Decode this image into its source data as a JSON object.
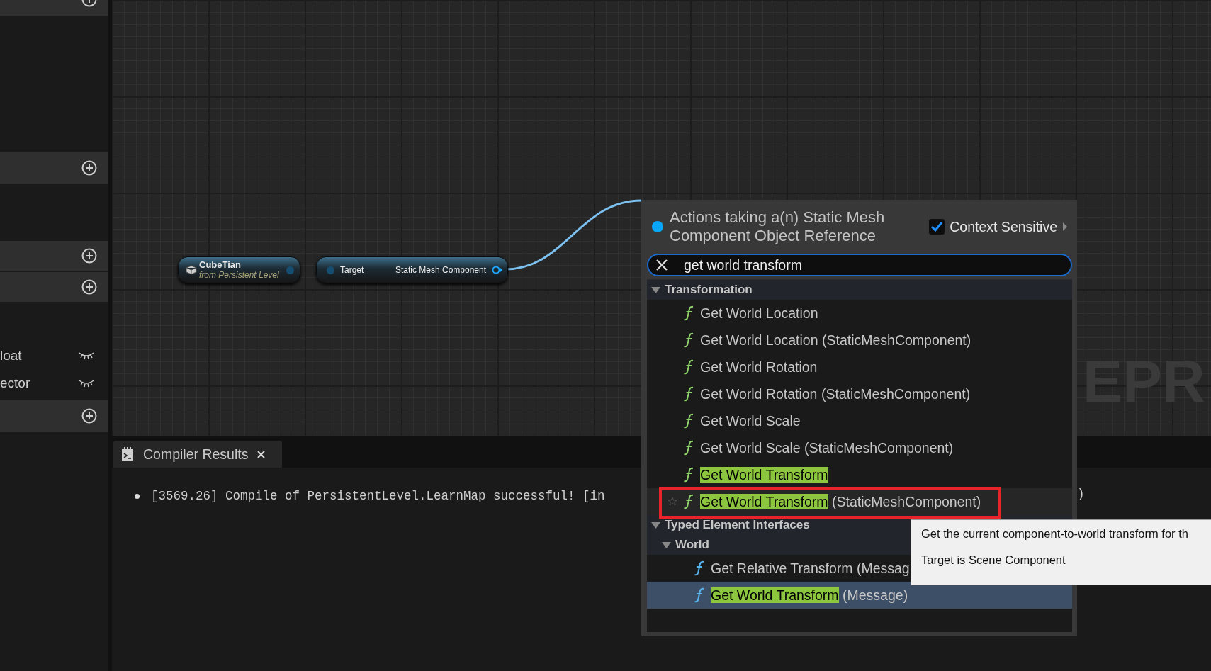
{
  "left_panel": {
    "rows": [
      {
        "kind": "section"
      },
      {
        "kind": "section"
      },
      {
        "kind": "section"
      },
      {
        "kind": "section"
      },
      {
        "kind": "variable",
        "label": "loat"
      },
      {
        "kind": "variable",
        "label": "ector"
      },
      {
        "kind": "section"
      }
    ]
  },
  "graph": {
    "nodes": [
      {
        "kind": "actor",
        "title": "CubeTian",
        "subtitle": "from Persistent Level"
      },
      {
        "kind": "getter",
        "input": "Target",
        "output": "Static Mesh Component"
      }
    ],
    "corner_label": "EPR"
  },
  "compiler": {
    "tab": "Compiler Results",
    "log": [
      "[3569.26] Compile of PersistentLevel.LearnMap successful! [in"
    ],
    "log_tail": ")"
  },
  "popup": {
    "title": "Actions taking a(n) Static Mesh Component Object Reference",
    "context_sensitive": {
      "label": "Context Sensitive",
      "checked": true
    },
    "search": {
      "value": "get world transform"
    },
    "tree": [
      {
        "kind": "category",
        "label": "Transformation",
        "expanded": true,
        "children": [
          {
            "kind": "function",
            "text": "Get World Location",
            "color": "#8fd46a",
            "selected": false,
            "hovered": false
          },
          {
            "kind": "function",
            "text": "Get World Location (StaticMeshComponent)",
            "color": "#8fd46a",
            "selected": false,
            "hovered": false
          },
          {
            "kind": "function",
            "text": "Get World Rotation",
            "color": "#8fd46a",
            "selected": false,
            "hovered": false
          },
          {
            "kind": "function",
            "text": "Get World Rotation (StaticMeshComponent)",
            "color": "#8fd46a",
            "selected": false,
            "hovered": false
          },
          {
            "kind": "function",
            "text": "Get World Scale",
            "color": "#8fd46a",
            "selected": false,
            "hovered": false
          },
          {
            "kind": "function",
            "text": "Get World Scale (StaticMeshComponent)",
            "color": "#8fd46a",
            "selected": false,
            "hovered": false
          },
          {
            "kind": "function",
            "match": "Get World Transform",
            "color": "#8fd46a",
            "selected": false,
            "hovered": false
          },
          {
            "kind": "function",
            "match": "Get World Transform",
            "text": " (StaticMeshComponent)",
            "color": "#8fd46a",
            "selected": false,
            "hovered": true
          }
        ]
      },
      {
        "kind": "category",
        "label": "Typed Element Interfaces",
        "expanded": true,
        "children": [
          {
            "kind": "category",
            "label": "World",
            "expanded": true,
            "children": [
              {
                "kind": "function",
                "text": "Get Relative Transform (Messag",
                "color": "#5ab4f0",
                "selected": false,
                "hovered": false
              },
              {
                "kind": "function",
                "match": "Get World Transform",
                "text": " (Message)",
                "color": "#5ab4f0",
                "selected": true,
                "hovered": false
              }
            ]
          }
        ]
      }
    ]
  },
  "tooltip": {
    "lines": [
      "Get the current component-to-world transform for th",
      "Target is Scene Component"
    ]
  }
}
